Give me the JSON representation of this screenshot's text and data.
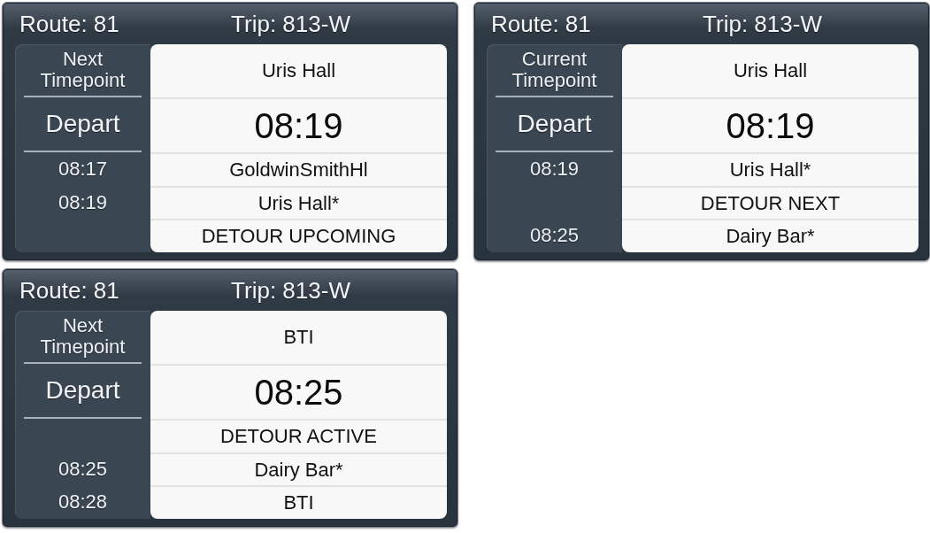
{
  "panels": [
    {
      "route": "Route: 81",
      "trip": "Trip: 813-W",
      "timepoint_label": "Next Timepoint",
      "action": "Depart",
      "stop": "Uris Hall",
      "time": "08:19",
      "rows": [
        {
          "time": "08:17",
          "stop": "GoldwinSmithHl"
        },
        {
          "time": "08:19",
          "stop": "Uris Hall*"
        },
        {
          "stop": "DETOUR UPCOMING"
        }
      ]
    },
    {
      "route": "Route: 81",
      "trip": "Trip: 813-W",
      "timepoint_label": "Current Timepoint",
      "action": "Depart",
      "stop": "Uris Hall",
      "time": "08:19",
      "rows": [
        {
          "time": "08:19",
          "stop": "Uris Hall*"
        },
        {
          "stop": "DETOUR NEXT"
        },
        {
          "time": "08:25",
          "stop": "Dairy Bar*"
        }
      ]
    },
    {
      "route": "Route: 81",
      "trip": "Trip: 813-W",
      "timepoint_label": "Next Timepoint",
      "action": "Depart",
      "stop": "BTI",
      "time": "08:25",
      "rows": [
        {
          "stop": "DETOUR ACTIVE"
        },
        {
          "time": "08:25",
          "stop": "Dairy Bar*"
        },
        {
          "time": "08:28",
          "stop": "BTI"
        }
      ]
    }
  ]
}
